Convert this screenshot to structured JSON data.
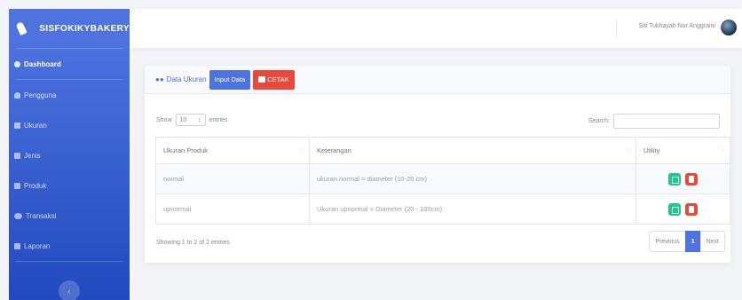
{
  "app": {
    "brand": "SISFOKIKYBAKERY"
  },
  "sidebar": {
    "items": [
      {
        "label": "Dashboard",
        "icon": "gauge-icon",
        "active": true
      },
      {
        "label": "Pengguna",
        "icon": "user-icon"
      },
      {
        "label": "Ukuran",
        "icon": "document-icon"
      },
      {
        "label": "Jenis",
        "icon": "document-icon"
      },
      {
        "label": "Produk",
        "icon": "document-icon"
      },
      {
        "label": "Transaksi",
        "icon": "users-icon"
      },
      {
        "label": "Laporan",
        "icon": "document-icon"
      }
    ],
    "toggle": "‹"
  },
  "topbar": {
    "user_name": "Siti Tukhayah Nur Anggraini"
  },
  "card": {
    "title": "Data Ukuran",
    "input_button": "Input Data",
    "print_button": "CETAK",
    "show_label": "Show",
    "entries_value": "10",
    "entries_label": "entries",
    "search_label": "Search:",
    "search_value": "",
    "columns": [
      "Ukuran Produk",
      "Keterangan",
      "Utility"
    ],
    "rows": [
      {
        "ukuran": "normal",
        "keterangan": "ukuran normal = diameter (10-20 cm)"
      },
      {
        "ukuran": "upnormal",
        "keterangan": "Ukuran upnormal = Diameter (20 - 100cm)"
      }
    ],
    "info": "Showing 1 to 2 of 2 entries",
    "pagination": {
      "prev": "Previous",
      "page": "1",
      "next": "Next"
    }
  },
  "colors": {
    "primary": "#4e73df",
    "success": "#1cc88a",
    "danger": "#e74a3b"
  }
}
